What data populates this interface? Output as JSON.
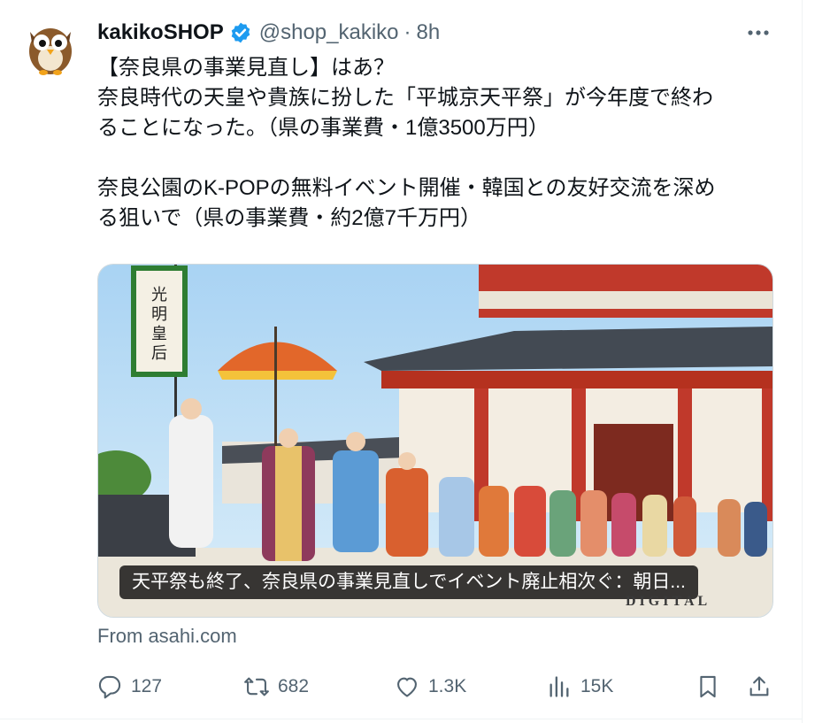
{
  "author": {
    "display_name": "kakikoSHOP",
    "handle": "@shop_kakiko",
    "separator": "·",
    "time": "8h",
    "avatar_icon": "owl-avatar",
    "verified_icon": "verified-badge-icon"
  },
  "more_icon": "more-dots-icon",
  "body": {
    "lines": [
      "【奈良県の事業見直し】はあ？",
      "奈良時代の天皇や貴族に扮した「平城京天平祭」が今年度で終わ",
      "ることになった。（県の事業費・1億3500万円）",
      "",
      "奈良公園のK-POPの無料イベント開催・韓国との友好交流を深め",
      "る狙いで（県の事業費・約2億7千万円）"
    ]
  },
  "card": {
    "caption": "天平祭も終了、奈良県の事業見直しでイベント廃止相次ぐ：朝日...",
    "watermark": "DIGITAL",
    "banner_text": "光明皇后"
  },
  "source": "From asahi.com",
  "actions": {
    "reply": {
      "icon": "reply-icon",
      "count": "127"
    },
    "retweet": {
      "icon": "retweet-icon",
      "count": "682"
    },
    "like": {
      "icon": "heart-icon",
      "count": "1.3K"
    },
    "views": {
      "icon": "views-icon",
      "count": "15K"
    },
    "bookmark": {
      "icon": "bookmark-icon"
    },
    "share": {
      "icon": "share-icon"
    }
  },
  "colors": {
    "text": "#0f1419",
    "secondary": "#536471",
    "verified": "#1d9bf0",
    "border": "#cfd9de"
  }
}
